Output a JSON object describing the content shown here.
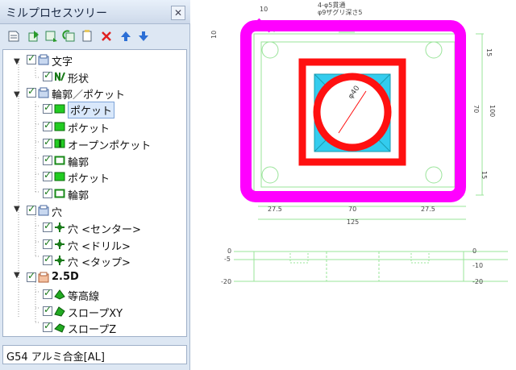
{
  "panel": {
    "title": "ミルプロセスツリー",
    "close_label": "✕"
  },
  "toolbar": {
    "buttons": [
      "new-process-icon",
      "import-icon",
      "add-step-icon",
      "copy-icon",
      "paste-icon",
      "delete-icon",
      "move-up-icon",
      "move-down-icon"
    ]
  },
  "tree": {
    "items": [
      {
        "label": "文字",
        "level": 0,
        "icon": "group-icon"
      },
      {
        "label": "形状",
        "level": 1,
        "icon": "shape-icon"
      },
      {
        "label": "輪郭／ポケット",
        "level": 0,
        "icon": "group-icon"
      },
      {
        "label": "ポケット",
        "level": 1,
        "icon": "pocket-icon",
        "selected": true
      },
      {
        "label": "ポケット",
        "level": 1,
        "icon": "pocket-icon"
      },
      {
        "label": "オープンポケット",
        "level": 1,
        "icon": "open-pocket-icon"
      },
      {
        "label": "輪郭",
        "level": 1,
        "icon": "contour-icon"
      },
      {
        "label": "ポケット",
        "level": 1,
        "icon": "pocket-icon"
      },
      {
        "label": "輪郭",
        "level": 1,
        "icon": "contour-icon"
      },
      {
        "label": "穴",
        "level": 0,
        "icon": "group-icon"
      },
      {
        "label": "穴 <センター>",
        "level": 1,
        "icon": "hole-icon"
      },
      {
        "label": "穴 <ドリル>",
        "level": 1,
        "icon": "hole-icon"
      },
      {
        "label": "穴 <タップ>",
        "level": 1,
        "icon": "hole-icon"
      },
      {
        "label": "2.5D",
        "level": 0,
        "icon": "group-2-5d-icon"
      },
      {
        "label": "等高線",
        "level": 1,
        "icon": "contour-line-icon"
      },
      {
        "label": "スロープXY",
        "level": 1,
        "icon": "slope-xy-icon"
      },
      {
        "label": "スロープZ",
        "level": 1,
        "icon": "slope-z-icon"
      }
    ]
  },
  "status": {
    "text": "G54 アルミ合金[AL]"
  },
  "drawing": {
    "top_note_1": "4-φ5貫通",
    "top_note_2": "φ9ザグリ深さ5",
    "dim_10": "10",
    "dim_15_top": "15",
    "dim_70_vert": "70",
    "dim_100": "100",
    "dim_15_bottom": "15",
    "dim_left": "10",
    "dim_phi": "φ40",
    "dim_27_5_left": "27.5",
    "dim_70_horiz": "70",
    "dim_27_5_right": "27.5",
    "dim_125": "125",
    "side_left_0": "0",
    "side_left_5": "-5",
    "side_left_20": "-20",
    "side_right_0": "0",
    "side_right_10": "-10",
    "side_right_20": "-20",
    "colors": {
      "outline": "#ff00ff",
      "pocket": "#ff1010",
      "fill": "#33ccee",
      "lines": "#22cc22"
    }
  }
}
